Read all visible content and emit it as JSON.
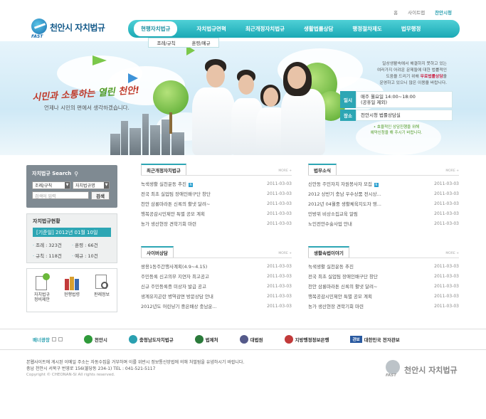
{
  "top_links": [
    "홈",
    "사이트맵",
    "찬안시청"
  ],
  "logo": {
    "mark": "FAST",
    "title": "천안시 자치법규"
  },
  "nav": [
    {
      "label": "현행자치법규",
      "active": true
    },
    {
      "label": "자치법규연혁"
    },
    {
      "label": "최근개정자치법규"
    },
    {
      "label": "생활법률상담"
    },
    {
      "label": "행정절차제도"
    },
    {
      "label": "법무행정"
    }
  ],
  "subnav": [
    "조례/규칙",
    "훈령/예규"
  ],
  "hero": {
    "slogan_red1": "시민과 소통하는 ",
    "slogan_green": "열린",
    "slogan_red2": " 천안!",
    "subslogan": "언제나 시민의 편에서 생각하겠습니다."
  },
  "info": {
    "line1": "일상생활속에서 해결하지 못하고 있는",
    "line2": "여러가지 어려운 문제들에 대한 법률적인",
    "line3_pre": "도움을 드리기 위해 ",
    "line3_hl": "무료법률상담",
    "line3_post": "을",
    "line4": "운영하고 있으니 많은 이용을 바랍니다.",
    "day_label": "일시",
    "day_value1": "매주 월요일 14:00~18:00",
    "day_value2": "(공휴일 제외)",
    "place_label": "장소",
    "place_value": "천안시청 법률상담실",
    "note1": "• 효율적인 상담진행을 위해",
    "note2": "예약신청을 해 주시기 바랍니다."
  },
  "search": {
    "title": "자치법규 Search",
    "select1": "조례/규칙",
    "select2": "자치법규명",
    "placeholder": "검색어 입력",
    "button": "검색"
  },
  "stats": {
    "title": "자치법규현황",
    "date": "[기준일] 2012년 01월 10일",
    "items": [
      "조례 : 323건",
      "훈령 : 66건",
      "규칙 : 118건",
      "예규 : 10건"
    ]
  },
  "quick": [
    {
      "label1": "자치법규",
      "label2": "정비제안"
    },
    {
      "label1": "현행법령",
      "label2": ""
    },
    {
      "label1": "판례정보",
      "label2": ""
    }
  ],
  "boards": {
    "recent": {
      "title": "최근개정자치법규",
      "more": "MORE +",
      "rows": [
        {
          "text": "녹색생활 실천운동 추진",
          "date": "2011-03-03",
          "new": true
        },
        {
          "text": "전국 최초 실업팀 장애인배구단 창단",
          "date": "2011-03-03"
        },
        {
          "text": "천안 삼룡마라톤 신록의 활냇 달려~",
          "date": "2011-03-03"
        },
        {
          "text": "행복공감시민제안 특별 공모 계획",
          "date": "2011-03-03"
        },
        {
          "text": "농가 생산현장 견학기회 마련",
          "date": "2011-03-03"
        }
      ]
    },
    "legal": {
      "title": "법무소식",
      "more": "MORE +",
      "rows": [
        {
          "text": "신안동 주민자치 자원봉사자 모집",
          "date": "2011-03-03",
          "new": true
        },
        {
          "text": "2012 상반기 충남 우수상품 전시상...",
          "date": "2011-03-03"
        },
        {
          "text": "2012년 04월중 생활체육지도자 영...",
          "date": "2011-03-03"
        },
        {
          "text": "민방위 비상소집교육 알림",
          "date": "2011-03-03"
        },
        {
          "text": "노인전안수술사업 안내",
          "date": "2011-03-03"
        }
      ]
    },
    "faq": {
      "title": "사이버상담",
      "more": "MORE +",
      "rows": [
        {
          "text": "쌍용1동주간행사계획(4.9~4.15)",
          "date": "2011-03-03"
        },
        {
          "text": "주민등록 신고의무 지연자 최고공고",
          "date": "2011-03-03"
        },
        {
          "text": "신규 주민등록증 미상자 발급 공고",
          "date": "2011-03-03"
        },
        {
          "text": "생계유지곤란 병역감면 방문상담 안내",
          "date": "2011-03-03"
        },
        {
          "text": "2012년도 어린냥기 중은배상 충남운...",
          "date": "2011-03-03"
        }
      ]
    },
    "life": {
      "title": "생활속법이야기",
      "more": "MORE +",
      "rows": [
        {
          "text": "녹색생활 실천운동 추진",
          "date": "2011-03-03"
        },
        {
          "text": "전국 최초 실업팀 장애인배구단 창단",
          "date": "2011-03-03"
        },
        {
          "text": "천안 삼룡마라톤 신록의 활냇 달려~",
          "date": "2011-03-03"
        },
        {
          "text": "행복공감시민제안 특별 공모 계획",
          "date": "2011-03-03"
        },
        {
          "text": "농가 생산현장 견학기회 마련",
          "date": "2011-03-03"
        }
      ]
    }
  },
  "banner": {
    "label": "배너광장",
    "items": [
      {
        "name": "천안시",
        "color": "#2f9a3a"
      },
      {
        "name": "충청남도자치법규",
        "color": "#2aa0b0"
      },
      {
        "name": "법제처",
        "color": "#2a7a3a"
      },
      {
        "name": "대법원",
        "color": "#555a8a"
      },
      {
        "name": "지방행정정보은행",
        "color": "#c23a3a"
      },
      {
        "name": "대한민국 전자관보",
        "color": "#2a5aa0",
        "tag": "관보"
      }
    ]
  },
  "footer": {
    "line1": "본웹사이트에 게시된 이메일 주소는 자동수집을 거부하며 이를 위반시 정보통신망법에 의해 처벌됨을 유념하시기 바랍니다.",
    "line2": "충남 천안시 서북구 번영로 156(불당동 234-1) TEL : 041-521-5117",
    "copy": "Copyright © CHEONAN-SI All rights reserved.",
    "logo_mark": "FAST",
    "logo_text": "천안시 자치법규"
  }
}
